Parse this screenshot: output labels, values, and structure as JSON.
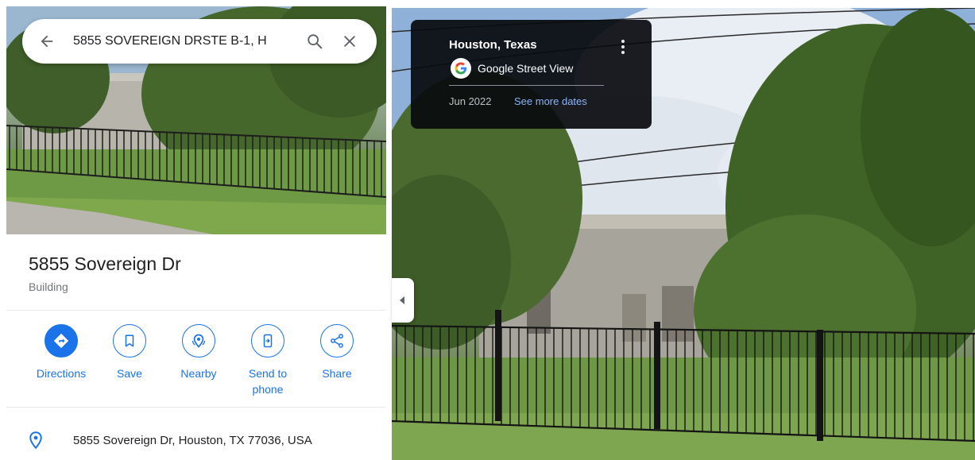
{
  "search": {
    "query": "5855 SOVEREIGN DRSTE B-1, H"
  },
  "place": {
    "title": "5855 Sovereign Dr",
    "category": "Building",
    "address": "5855 Sovereign Dr, Houston, TX 77036, USA"
  },
  "actions": [
    {
      "label": "Directions",
      "icon": "directions-icon"
    },
    {
      "label": "Save",
      "icon": "bookmark-icon"
    },
    {
      "label": "Nearby",
      "icon": "nearby-icon"
    },
    {
      "label": "Send to phone",
      "icon": "send-to-phone-icon"
    },
    {
      "label": "Share",
      "icon": "share-icon"
    }
  ],
  "street_view": {
    "location": "Houston, Texas",
    "brand": "Google Street View",
    "date": "Jun 2022",
    "more_dates_label": "See more dates"
  },
  "colors": {
    "accent": "#1a73e8",
    "link_dark": "#8ab4f8",
    "card_bg": "#080a0e"
  }
}
